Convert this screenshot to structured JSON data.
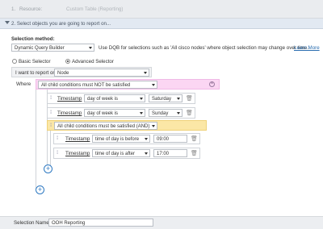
{
  "step1": {
    "number": "1.",
    "label": "Resource:",
    "value": "Custom Table (Reporting)"
  },
  "step2": {
    "label": "2. Select objects you are going to report on..."
  },
  "selection_method": {
    "heading": "Selection method:",
    "value": "Dynamic Query Builder",
    "hint": "Use DQB for selections such as 'All cisco nodes' where object selection may change over time.",
    "learn_more": "Learn More"
  },
  "selector": {
    "basic": "Basic Selector",
    "advanced": "Advanced Selector",
    "selected": "advanced"
  },
  "report_on": {
    "label": "I want to report on",
    "value": "Node"
  },
  "where": {
    "label": "Where",
    "group_condition": "All child conditions must NOT be satisfied",
    "conditions": [
      {
        "field": "Timestamp",
        "operator": "day of week is",
        "value": "Saturday"
      },
      {
        "field": "Timestamp",
        "operator": "day of week is",
        "value": "Sunday"
      }
    ],
    "subgroup": {
      "condition": "All child conditions must be satisfied (AND)",
      "conditions": [
        {
          "field": "Timestamp",
          "operator": "time of day is before",
          "value": "09:00"
        },
        {
          "field": "Timestamp",
          "operator": "time of day is after",
          "value": "17:00"
        }
      ]
    }
  },
  "selection_name": {
    "label": "Selection Name:",
    "value": "OOH Reporting"
  },
  "icons": {
    "handle": "drag-handle-icon",
    "trash": "trash-icon",
    "plus": "add-icon",
    "remove": "remove-circle-icon"
  }
}
